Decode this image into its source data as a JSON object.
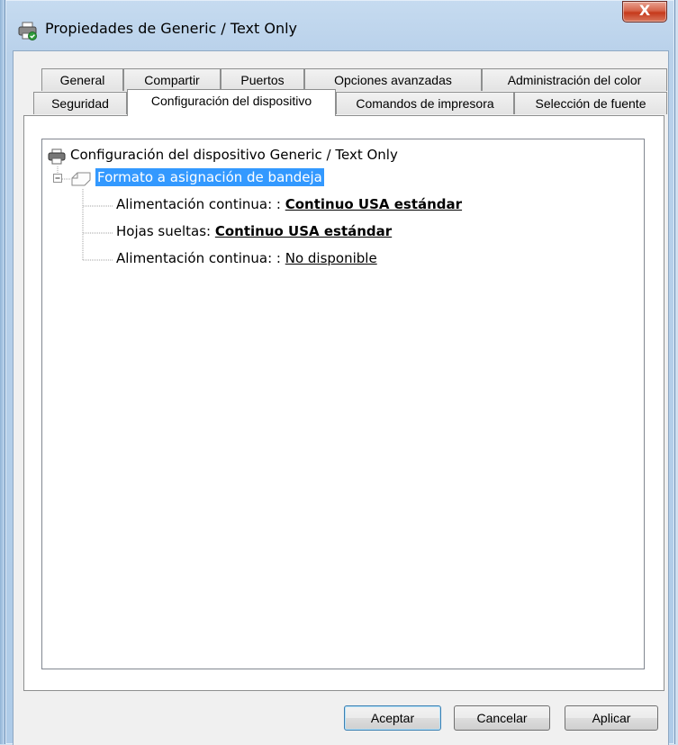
{
  "window": {
    "title": "Propiedades de Generic / Text Only",
    "close_label": "X"
  },
  "tabs_back": [
    "General",
    "Compartir",
    "Puertos",
    "Opciones avanzadas",
    "Administración del color"
  ],
  "tabs_front": [
    "Seguridad",
    "Configuración del dispositivo",
    "Comandos de impresora",
    "Selección de fuente"
  ],
  "active_tab": "Configuración del dispositivo",
  "tree": {
    "root": "Configuración del dispositivo Generic / Text Only",
    "group": "Formato a asignación de bandeja",
    "items": [
      {
        "label": "Alimentación continua: :",
        "value": "Continuo USA estándar"
      },
      {
        "label": "Hojas sueltas:",
        "value": "Continuo USA estándar"
      },
      {
        "label": "Alimentación continua: :",
        "value": "No disponible"
      }
    ]
  },
  "buttons": {
    "ok": "Aceptar",
    "cancel": "Cancelar",
    "apply": "Aplicar"
  },
  "icons": {
    "title": "printer-icon",
    "root": "printer-icon",
    "group": "tray-icon",
    "collapse": "minus-box-icon"
  }
}
